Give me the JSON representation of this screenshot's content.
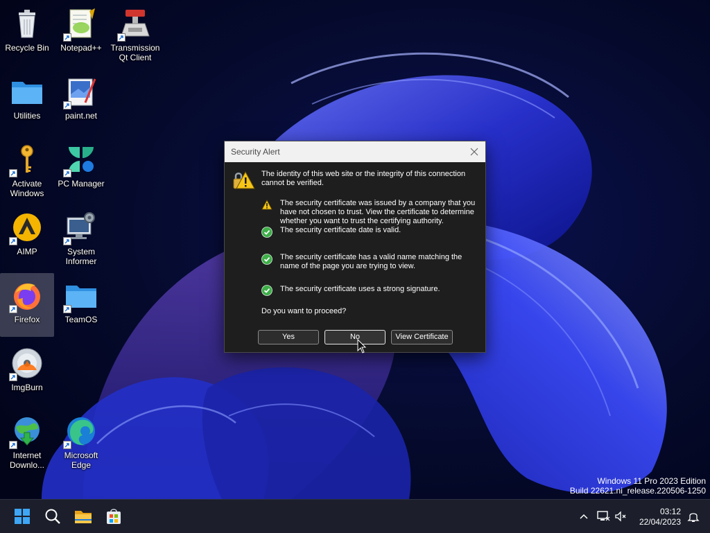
{
  "desktop": {
    "icons": [
      {
        "label": "Recycle Bin"
      },
      {
        "label": "Notepad++"
      },
      {
        "label": "Transmission Qt Client"
      },
      {
        "label": "Utilities"
      },
      {
        "label": "paint.net"
      },
      {
        "label": "Activate Windows"
      },
      {
        "label": "PC Manager"
      },
      {
        "label": "AIMP"
      },
      {
        "label": "System Informer"
      },
      {
        "label": "Firefox"
      },
      {
        "label": "TeamOS"
      },
      {
        "label": "ImgBurn"
      },
      {
        "label": "Internet Downlo..."
      },
      {
        "label": "Microsoft Edge"
      }
    ],
    "watermark_line1": "Windows 11 Pro 2023 Edition",
    "watermark_line2": "Build 22621.ni_release.220506-1250"
  },
  "dialog": {
    "title": "Security Alert",
    "intro": "The identity of this web site or the integrity of this connection cannot be verified.",
    "items": [
      {
        "status": "warning",
        "text": "The security certificate was issued by a company that you have not chosen to trust. View the certificate to determine whether you want to trust the certifying authority."
      },
      {
        "status": "ok",
        "text": "The security certificate date is valid."
      },
      {
        "status": "ok",
        "text": "The security certificate has a valid name matching the name of the page you are trying to view."
      },
      {
        "status": "ok",
        "text": "The security certificate uses a strong signature."
      }
    ],
    "question": "Do you want to proceed?",
    "buttons": {
      "yes": "Yes",
      "no": "No",
      "view": "View Certificate"
    }
  },
  "taskbar": {
    "clock_time": "03:12",
    "clock_date": "22/04/2023"
  },
  "colors": {
    "accent": "#0078d4",
    "warning": "#f5c518",
    "ok": "#3fae49",
    "dialog_bg": "#1e1e1e",
    "taskbar_bg": "#1c1f2b"
  }
}
